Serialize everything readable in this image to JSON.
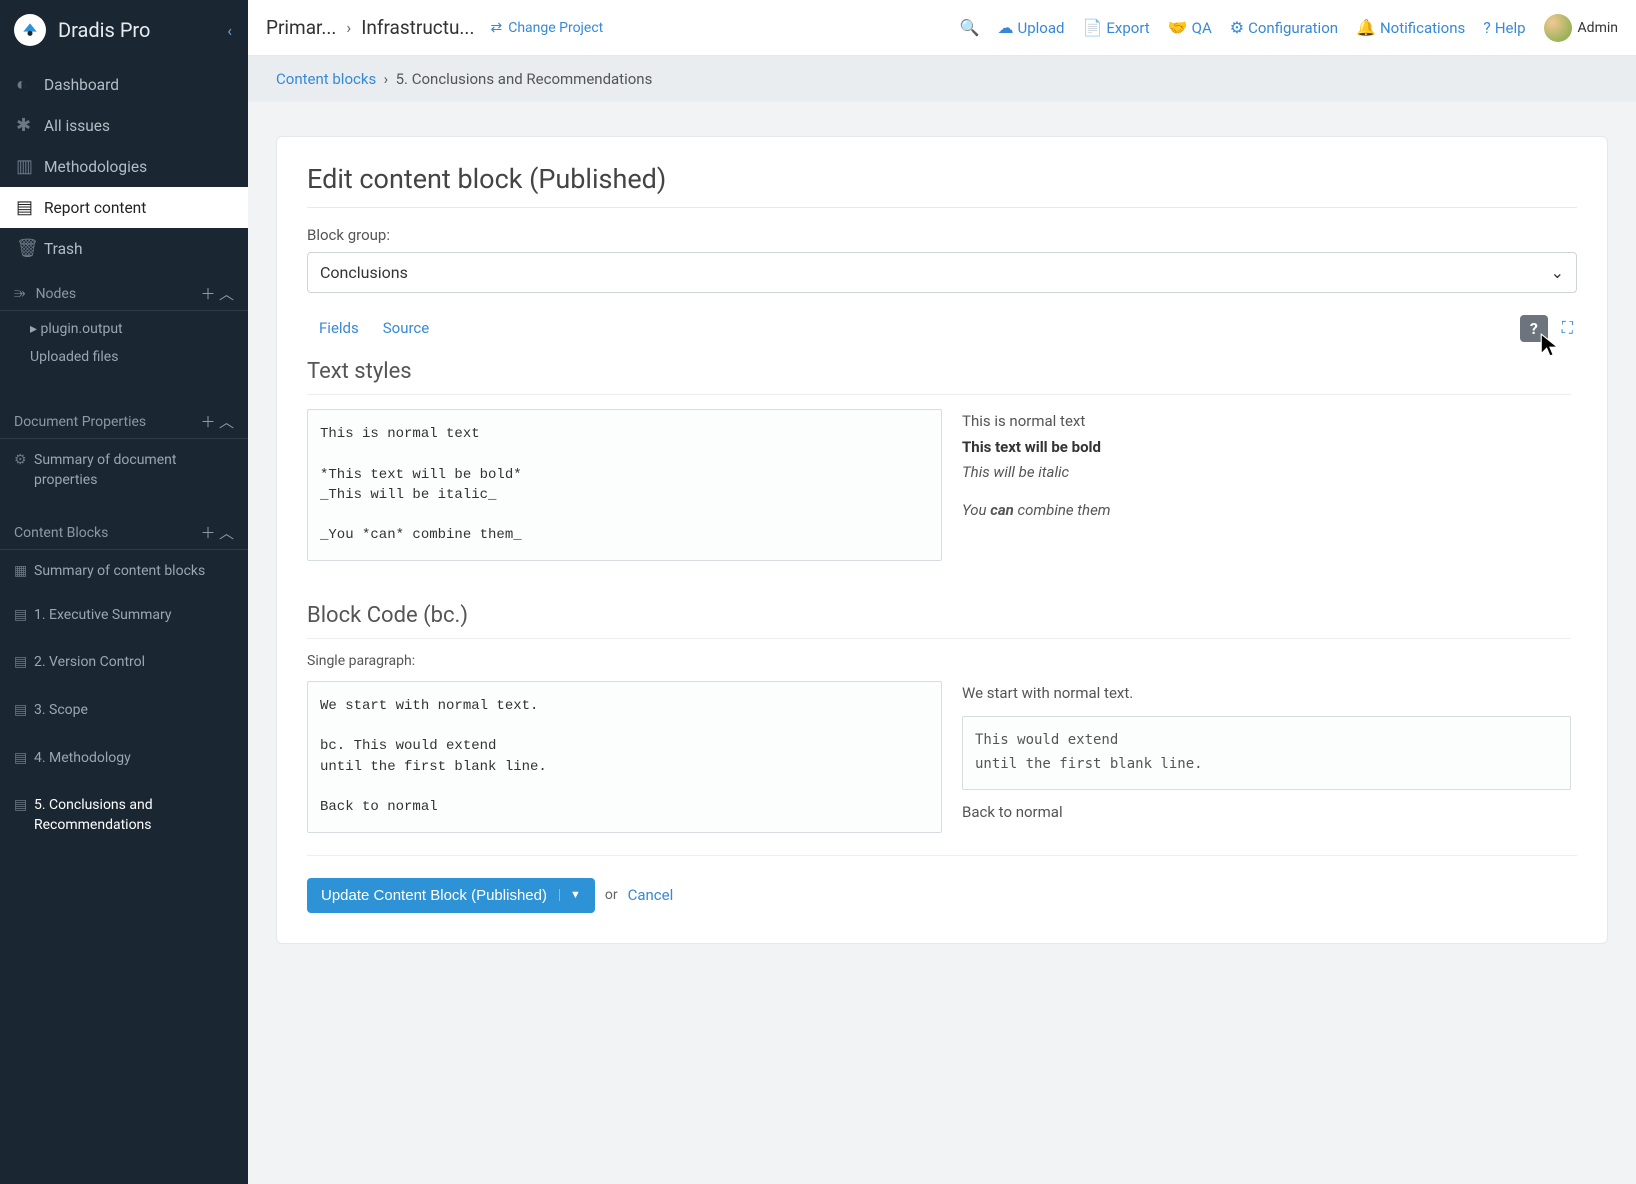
{
  "brand": "Dradis Pro",
  "sidebar": {
    "items": [
      {
        "label": "Dashboard"
      },
      {
        "label": "All issues"
      },
      {
        "label": "Methodologies"
      },
      {
        "label": "Report content"
      },
      {
        "label": "Trash"
      }
    ],
    "nodes_header": "Nodes",
    "nodes": [
      {
        "label": "plugin.output"
      },
      {
        "label": "Uploaded files"
      }
    ],
    "docprops_header": "Document Properties",
    "docprops_link": "Summary of document properties",
    "cblocks_header": "Content Blocks",
    "cblocks_summary": "Summary of content blocks",
    "cblocks": [
      {
        "label": "1. Executive Summary"
      },
      {
        "label": "2. Version Control"
      },
      {
        "label": "3. Scope"
      },
      {
        "label": "4. Methodology"
      },
      {
        "label": "5. Conclusions and Recommendations"
      }
    ]
  },
  "topbar": {
    "crumb1": "Primar...",
    "crumb2": "Infrastructu...",
    "change": "Change Project",
    "upload": "Upload",
    "export": "Export",
    "qa": "QA",
    "config": "Configuration",
    "notif": "Notifications",
    "help": "Help",
    "admin": "Admin"
  },
  "breadcrumb": {
    "a": "Content blocks",
    "b": "5. Conclusions and Recommendations"
  },
  "panel": {
    "title": "Edit content block (Published)",
    "group_label": "Block group:",
    "group_value": "Conclusions",
    "tab_fields": "Fields",
    "tab_source": "Source",
    "sec_textstyles": "Text styles",
    "code_textstyles": "This is normal text\n\n*This text will be bold*\n_This will be italic_\n\n_You *can* combine them_",
    "prev_normal": "This is normal text",
    "prev_bold": "This text will be bold",
    "prev_italic": "This will be italic",
    "prev_combine_pre": "You ",
    "prev_combine_b": "can",
    "prev_combine_post": " combine them",
    "sec_blockcode": "Block Code (bc.)",
    "single_p": "Single paragraph:",
    "code_block": "We start with normal text.\n\nbc. This would extend\nuntil the first blank line.\n\nBack to normal",
    "prev_bc_1": "We start with normal text.",
    "prev_bc_code": "This would extend\nuntil the first blank line.",
    "prev_bc_2": "Back to normal",
    "update": "Update Content Block (Published)",
    "or": "or",
    "cancel": "Cancel"
  }
}
